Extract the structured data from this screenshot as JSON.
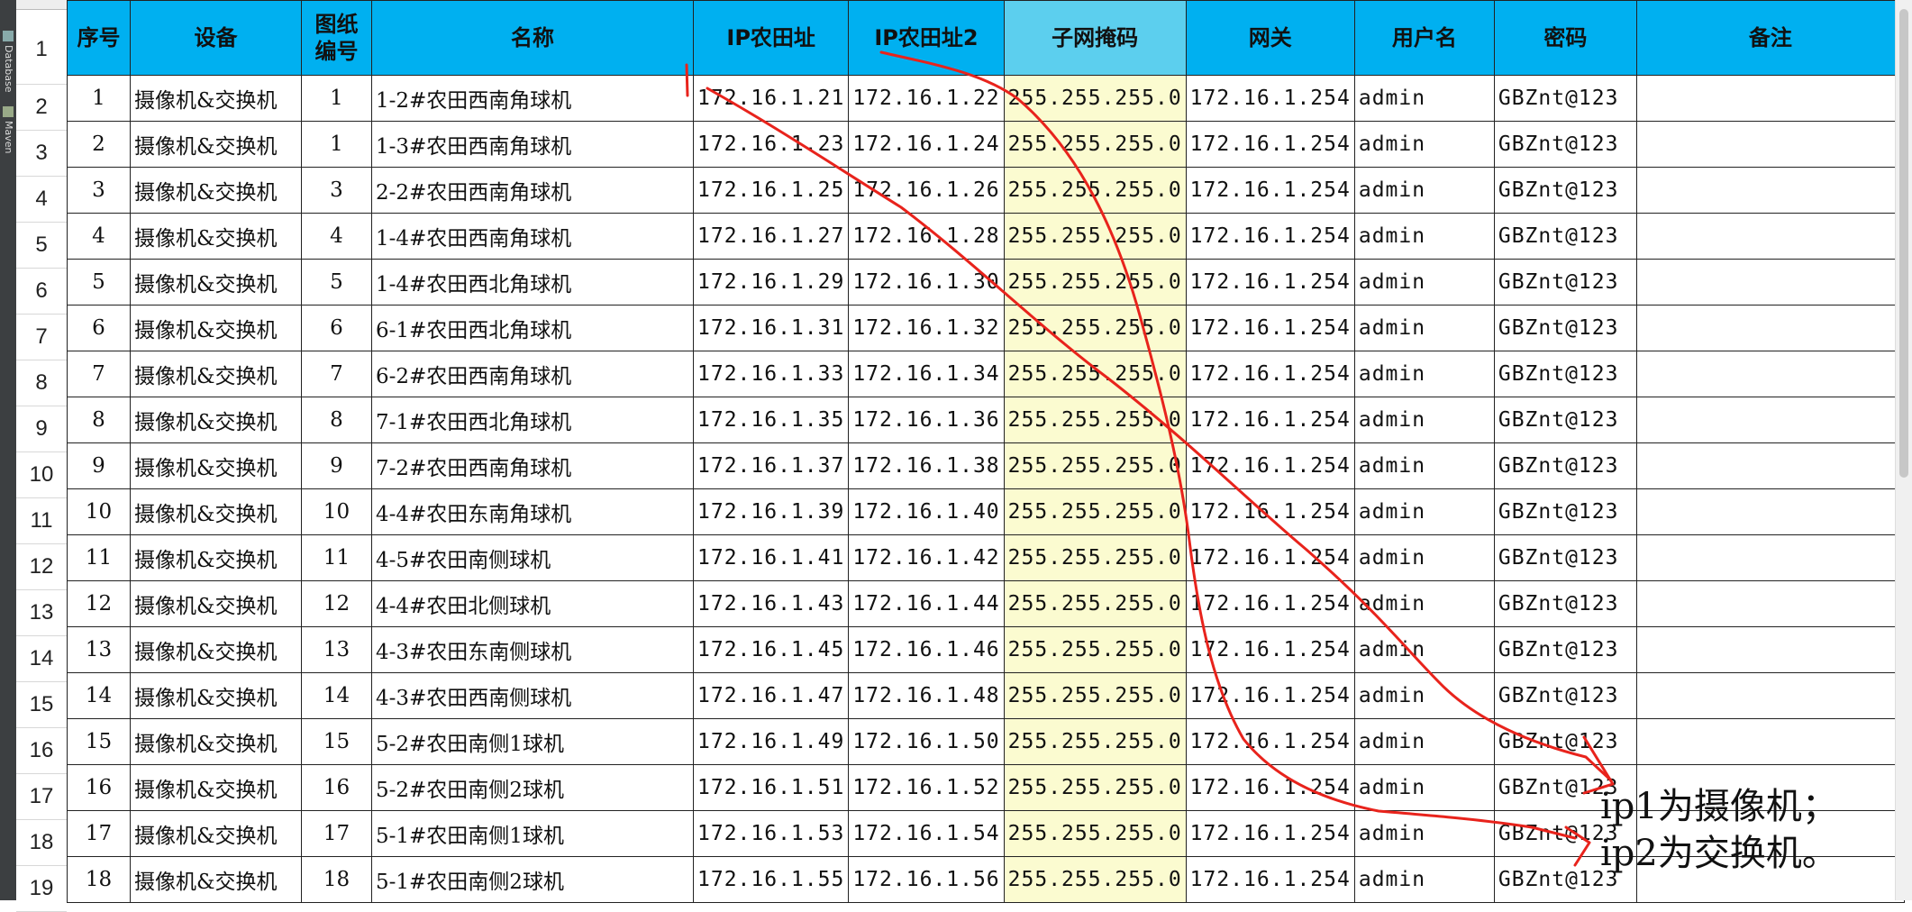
{
  "side_tabs": [
    "Database",
    "Maven"
  ],
  "header": {
    "row_num": "1",
    "cols": [
      "序号",
      "设备",
      "图纸\n编号",
      "名称",
      "IP农田址",
      "IP农田址2",
      "子网掩码",
      "网关",
      "用户名",
      "密码",
      "备注"
    ]
  },
  "rows": [
    {
      "rn": "2",
      "seq": "1",
      "device": "摄像机&交换机",
      "draw": "1",
      "name": "1-2#农田西南角球机",
      "ip1": "172.16.1.21",
      "ip2": "172.16.1.22",
      "mask": "255.255.255.0",
      "gw": "172.16.1.254",
      "user": "admin",
      "pwd": "GBZnt@123"
    },
    {
      "rn": "3",
      "seq": "2",
      "device": "摄像机&交换机",
      "draw": "1",
      "name": "1-3#农田西南角球机",
      "ip1": "172.16.1.23",
      "ip2": "172.16.1.24",
      "mask": "255.255.255.0",
      "gw": "172.16.1.254",
      "user": "admin",
      "pwd": "GBZnt@123"
    },
    {
      "rn": "4",
      "seq": "3",
      "device": "摄像机&交换机",
      "draw": "3",
      "name": "2-2#农田西南角球机",
      "ip1": "172.16.1.25",
      "ip2": "172.16.1.26",
      "mask": "255.255.255.0",
      "gw": "172.16.1.254",
      "user": "admin",
      "pwd": "GBZnt@123"
    },
    {
      "rn": "5",
      "seq": "4",
      "device": "摄像机&交换机",
      "draw": "4",
      "name": "1-4#农田西南角球机",
      "ip1": "172.16.1.27",
      "ip2": "172.16.1.28",
      "mask": "255.255.255.0",
      "gw": "172.16.1.254",
      "user": "admin",
      "pwd": "GBZnt@123"
    },
    {
      "rn": "6",
      "seq": "5",
      "device": "摄像机&交换机",
      "draw": "5",
      "name": "1-4#农田西北角球机",
      "ip1": "172.16.1.29",
      "ip2": "172.16.1.30",
      "mask": "255.255.255.0",
      "gw": "172.16.1.254",
      "user": "admin",
      "pwd": "GBZnt@123"
    },
    {
      "rn": "7",
      "seq": "6",
      "device": "摄像机&交换机",
      "draw": "6",
      "name": "6-1#农田西北角球机",
      "ip1": "172.16.1.31",
      "ip2": "172.16.1.32",
      "mask": "255.255.255.0",
      "gw": "172.16.1.254",
      "user": "admin",
      "pwd": "GBZnt@123"
    },
    {
      "rn": "8",
      "seq": "7",
      "device": "摄像机&交换机",
      "draw": "7",
      "name": "6-2#农田西南角球机",
      "ip1": "172.16.1.33",
      "ip2": "172.16.1.34",
      "mask": "255.255.255.0",
      "gw": "172.16.1.254",
      "user": "admin",
      "pwd": "GBZnt@123"
    },
    {
      "rn": "9",
      "seq": "8",
      "device": "摄像机&交换机",
      "draw": "8",
      "name": "7-1#农田西北角球机",
      "ip1": "172.16.1.35",
      "ip2": "172.16.1.36",
      "mask": "255.255.255.0",
      "gw": "172.16.1.254",
      "user": "admin",
      "pwd": "GBZnt@123"
    },
    {
      "rn": "10",
      "seq": "9",
      "device": "摄像机&交换机",
      "draw": "9",
      "name": "7-2#农田西南角球机",
      "ip1": "172.16.1.37",
      "ip2": "172.16.1.38",
      "mask": "255.255.255.0",
      "gw": "172.16.1.254",
      "user": "admin",
      "pwd": "GBZnt@123"
    },
    {
      "rn": "11",
      "seq": "10",
      "device": "摄像机&交换机",
      "draw": "10",
      "name": "4-4#农田东南角球机",
      "ip1": "172.16.1.39",
      "ip2": "172.16.1.40",
      "mask": "255.255.255.0",
      "gw": "172.16.1.254",
      "user": "admin",
      "pwd": "GBZnt@123"
    },
    {
      "rn": "12",
      "seq": "11",
      "device": "摄像机&交换机",
      "draw": "11",
      "name": "4-5#农田南侧球机",
      "ip1": "172.16.1.41",
      "ip2": "172.16.1.42",
      "mask": "255.255.255.0",
      "gw": "172.16.1.254",
      "user": "admin",
      "pwd": "GBZnt@123"
    },
    {
      "rn": "13",
      "seq": "12",
      "device": "摄像机&交换机",
      "draw": "12",
      "name": "4-4#农田北侧球机",
      "ip1": "172.16.1.43",
      "ip2": "172.16.1.44",
      "mask": "255.255.255.0",
      "gw": "172.16.1.254",
      "user": "admin",
      "pwd": "GBZnt@123"
    },
    {
      "rn": "14",
      "seq": "13",
      "device": "摄像机&交换机",
      "draw": "13",
      "name": "4-3#农田东南侧球机",
      "ip1": "172.16.1.45",
      "ip2": "172.16.1.46",
      "mask": "255.255.255.0",
      "gw": "172.16.1.254",
      "user": "admin",
      "pwd": "GBZnt@123"
    },
    {
      "rn": "15",
      "seq": "14",
      "device": "摄像机&交换机",
      "draw": "14",
      "name": "4-3#农田西南侧球机",
      "ip1": "172.16.1.47",
      "ip2": "172.16.1.48",
      "mask": "255.255.255.0",
      "gw": "172.16.1.254",
      "user": "admin",
      "pwd": "GBZnt@123"
    },
    {
      "rn": "16",
      "seq": "15",
      "device": "摄像机&交换机",
      "draw": "15",
      "name": "5-2#农田南侧1球机",
      "ip1": "172.16.1.49",
      "ip2": "172.16.1.50",
      "mask": "255.255.255.0",
      "gw": "172.16.1.254",
      "user": "admin",
      "pwd": "GBZnt@123"
    },
    {
      "rn": "17",
      "seq": "16",
      "device": "摄像机&交换机",
      "draw": "16",
      "name": "5-2#农田南侧2球机",
      "ip1": "172.16.1.51",
      "ip2": "172.16.1.52",
      "mask": "255.255.255.0",
      "gw": "172.16.1.254",
      "user": "admin",
      "pwd": "GBZnt@123"
    },
    {
      "rn": "18",
      "seq": "17",
      "device": "摄像机&交换机",
      "draw": "17",
      "name": "5-1#农田南侧1球机",
      "ip1": "172.16.1.53",
      "ip2": "172.16.1.54",
      "mask": "255.255.255.0",
      "gw": "172.16.1.254",
      "user": "admin",
      "pwd": "GBZnt@123"
    },
    {
      "rn": "19",
      "seq": "18",
      "device": "摄像机&交换机",
      "draw": "18",
      "name": "5-1#农田南侧2球机",
      "ip1": "172.16.1.55",
      "ip2": "172.16.1.56",
      "mask": "255.255.255.0",
      "gw": "172.16.1.254",
      "user": "admin",
      "pwd": "GBZnt@123"
    }
  ],
  "annotation": {
    "line1": "ip1为摄像机；",
    "line2": "ip2为交换机。",
    "ink_color": "#e8231c"
  },
  "colors": {
    "header_bg": "#00b0f0",
    "mask_header_bg": "#5ccfee",
    "mask_col_bg": "#fbfbd0"
  }
}
